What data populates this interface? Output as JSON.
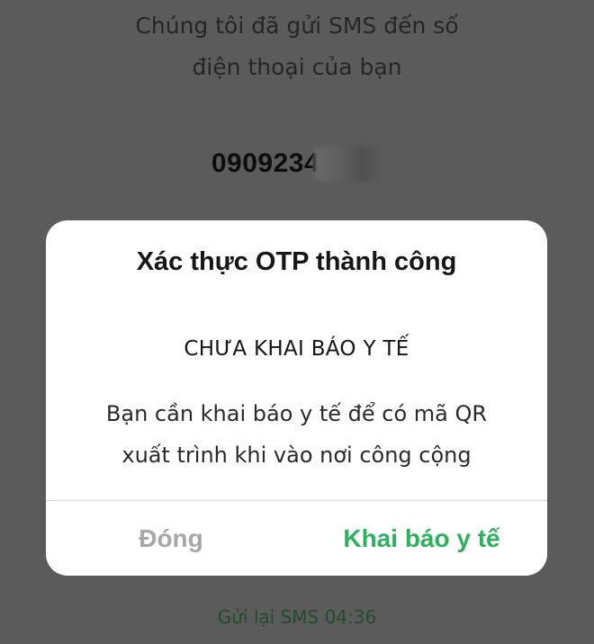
{
  "background_screen": {
    "sms_message_lines": [
      "Chúng tôi đã gửi SMS đến số",
      "điện thoại của bạn"
    ],
    "phone_number_visible": "0909234",
    "resend_label": "Gửi lại SMS 04:36"
  },
  "dialog": {
    "title": "Xác thực OTP thành công",
    "status_heading": "CHƯA KHAI BÁO Y TẾ",
    "message_lines": [
      "Bạn cần khai báo y tế để có mã QR",
      "xuất trình khi vào nơi công cộng"
    ],
    "buttons": {
      "close_label": "Đóng",
      "declare_label": "Khai báo y tế"
    }
  },
  "colors": {
    "overlay_background": "#5b5b5b",
    "accent_green": "#2eb15d",
    "disabled_gray": "#a7a7a7"
  }
}
